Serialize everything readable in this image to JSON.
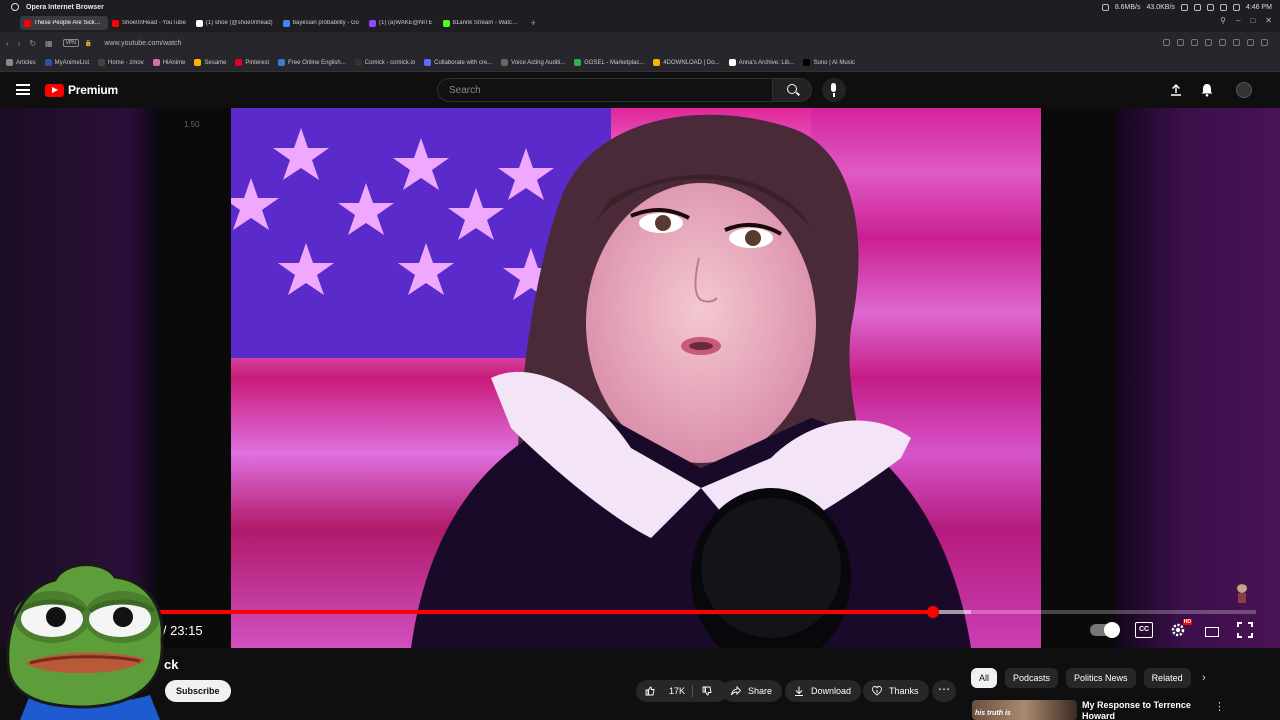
{
  "os": {
    "app_name": "Opera Internet Browser",
    "net_up": "8.6MB/s",
    "net_down": "43.0KB/s",
    "clock": "4:46 PM"
  },
  "tabs": [
    {
      "title": "These People Are Sick - Y",
      "color": "#ff0000",
      "active": true
    },
    {
      "title": "Shoe0nHead - YouTube",
      "color": "#ff0000",
      "active": false
    },
    {
      "title": "(1) shoe (@shoe0nhead)",
      "color": "#ffffff",
      "active": false
    },
    {
      "title": "bayesian probability - Go",
      "color": "#4285f4",
      "active": false
    },
    {
      "title": "(1) (a)WAKE@NITE",
      "color": "#9146ff",
      "active": false
    },
    {
      "title": "b1annk Stream - Watch Li",
      "color": "#53fc18",
      "active": false
    }
  ],
  "address": {
    "vpn": "VPN",
    "url": "www.youtube.com/watch"
  },
  "bookmarks": [
    {
      "label": "Articles",
      "color": "#888888"
    },
    {
      "label": "MyAnimeList",
      "color": "#2e51a2"
    },
    {
      "label": "Home - zmov",
      "color": "#444444"
    },
    {
      "label": "HiAnime",
      "color": "#d36fa6"
    },
    {
      "label": "Sesame",
      "color": "#ffb300"
    },
    {
      "label": "Pinterest",
      "color": "#e60023"
    },
    {
      "label": "Free Online English...",
      "color": "#3a7bd5"
    },
    {
      "label": "Comick - comick.io",
      "color": "#333333"
    },
    {
      "label": "Collaborate with cre...",
      "color": "#5b6cff"
    },
    {
      "label": "Voice Acting Auditi...",
      "color": "#666666"
    },
    {
      "label": "GGSEL - Marketplac...",
      "color": "#2bb24c"
    },
    {
      "label": "4DOWNLOAD | Do...",
      "color": "#f2b705"
    },
    {
      "label": "Anna's Archive: Lib...",
      "color": "#ffffff"
    },
    {
      "label": "Suno | AI Music",
      "color": "#000000"
    }
  ],
  "header": {
    "logo_text": "Premium",
    "search_placeholder": "Search"
  },
  "player": {
    "speed_label": "1.50",
    "time_display": "1 / 23:15",
    "progress": 0.705,
    "buffered": 0.74,
    "hd_badge": "HD",
    "cc_label": "CC"
  },
  "video": {
    "title_fragment": "ck"
  },
  "actions": {
    "subscribe": "Subscribe",
    "likes": "17K",
    "share": "Share",
    "download": "Download",
    "thanks": "Thanks"
  },
  "chips": [
    "All",
    "Podcasts",
    "Politics News",
    "Related"
  ],
  "recommendation": {
    "title": "My Response to Terrence Howard",
    "thumb_text": "his truth is"
  }
}
